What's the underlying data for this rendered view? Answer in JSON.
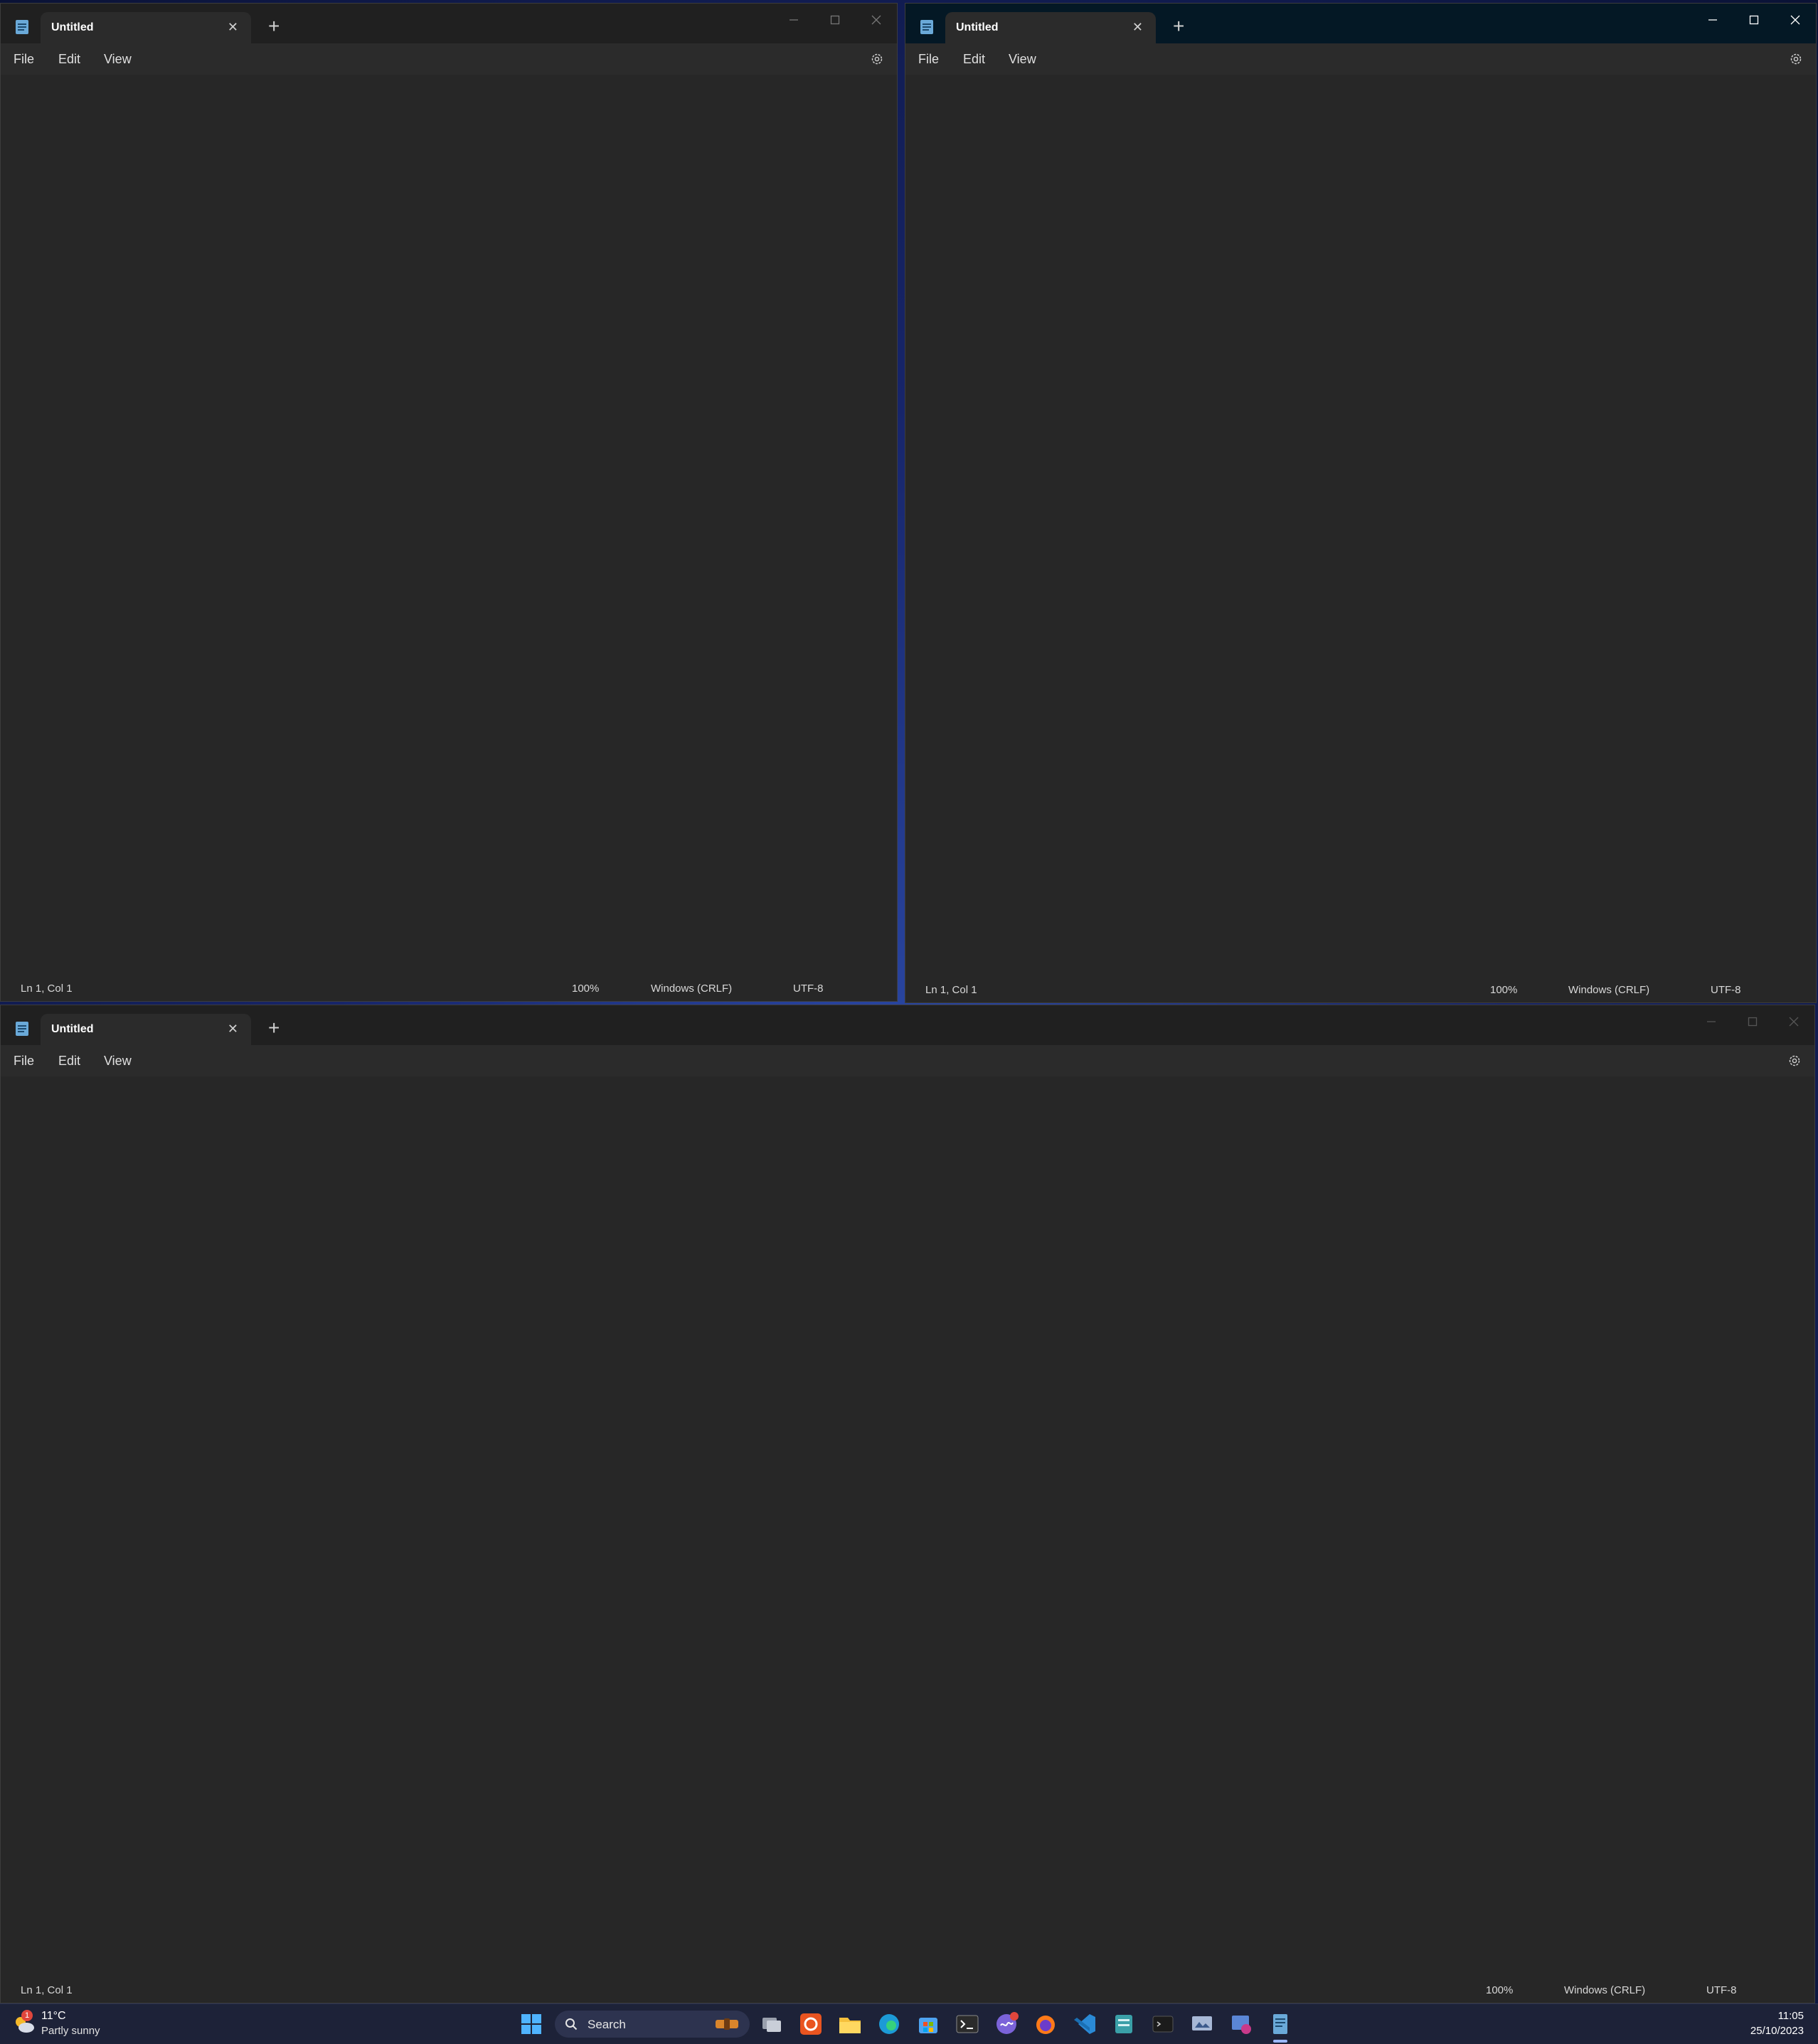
{
  "windows": {
    "top_left": {
      "tab_title": "Untitled",
      "menu": {
        "file": "File",
        "edit": "Edit",
        "view": "View"
      },
      "status": {
        "position": "Ln 1, Col 1",
        "zoom": "100%",
        "line_ending": "Windows (CRLF)",
        "encoding": "UTF-8"
      },
      "focused": false
    },
    "top_right": {
      "tab_title": "Untitled",
      "menu": {
        "file": "File",
        "edit": "Edit",
        "view": "View"
      },
      "status": {
        "position": "Ln 1, Col 1",
        "zoom": "100%",
        "line_ending": "Windows (CRLF)",
        "encoding": "UTF-8"
      },
      "focused": true
    },
    "bottom": {
      "tab_title": "Untitled",
      "menu": {
        "file": "File",
        "edit": "Edit",
        "view": "View"
      },
      "status": {
        "position": "Ln 1, Col 1",
        "zoom": "100%",
        "line_ending": "Windows (CRLF)",
        "encoding": "UTF-8"
      },
      "focused": false
    }
  },
  "taskbar": {
    "weather": {
      "temp": "11°C",
      "desc": "Partly sunny",
      "badge": "1"
    },
    "search_label": "Search",
    "apps": [
      "windows-start-icon",
      "task-view-icon",
      "ubuntu-icon",
      "file-explorer-icon",
      "edge-icon",
      "store-icon",
      "terminal-icon",
      "teams-icon",
      "firefox-icon",
      "vscode-icon",
      "app-icon",
      "terminal-app-icon",
      "remote-desktop-icon",
      "snipping-icon",
      "notepad-icon"
    ],
    "clock": {
      "time": "11:05",
      "date": "25/10/2023"
    }
  },
  "colors": {
    "window_bg": "#272727",
    "titlebar": "#202020",
    "focused_titlebar": "#041825",
    "desktop_accent": "#2c4aa8"
  }
}
